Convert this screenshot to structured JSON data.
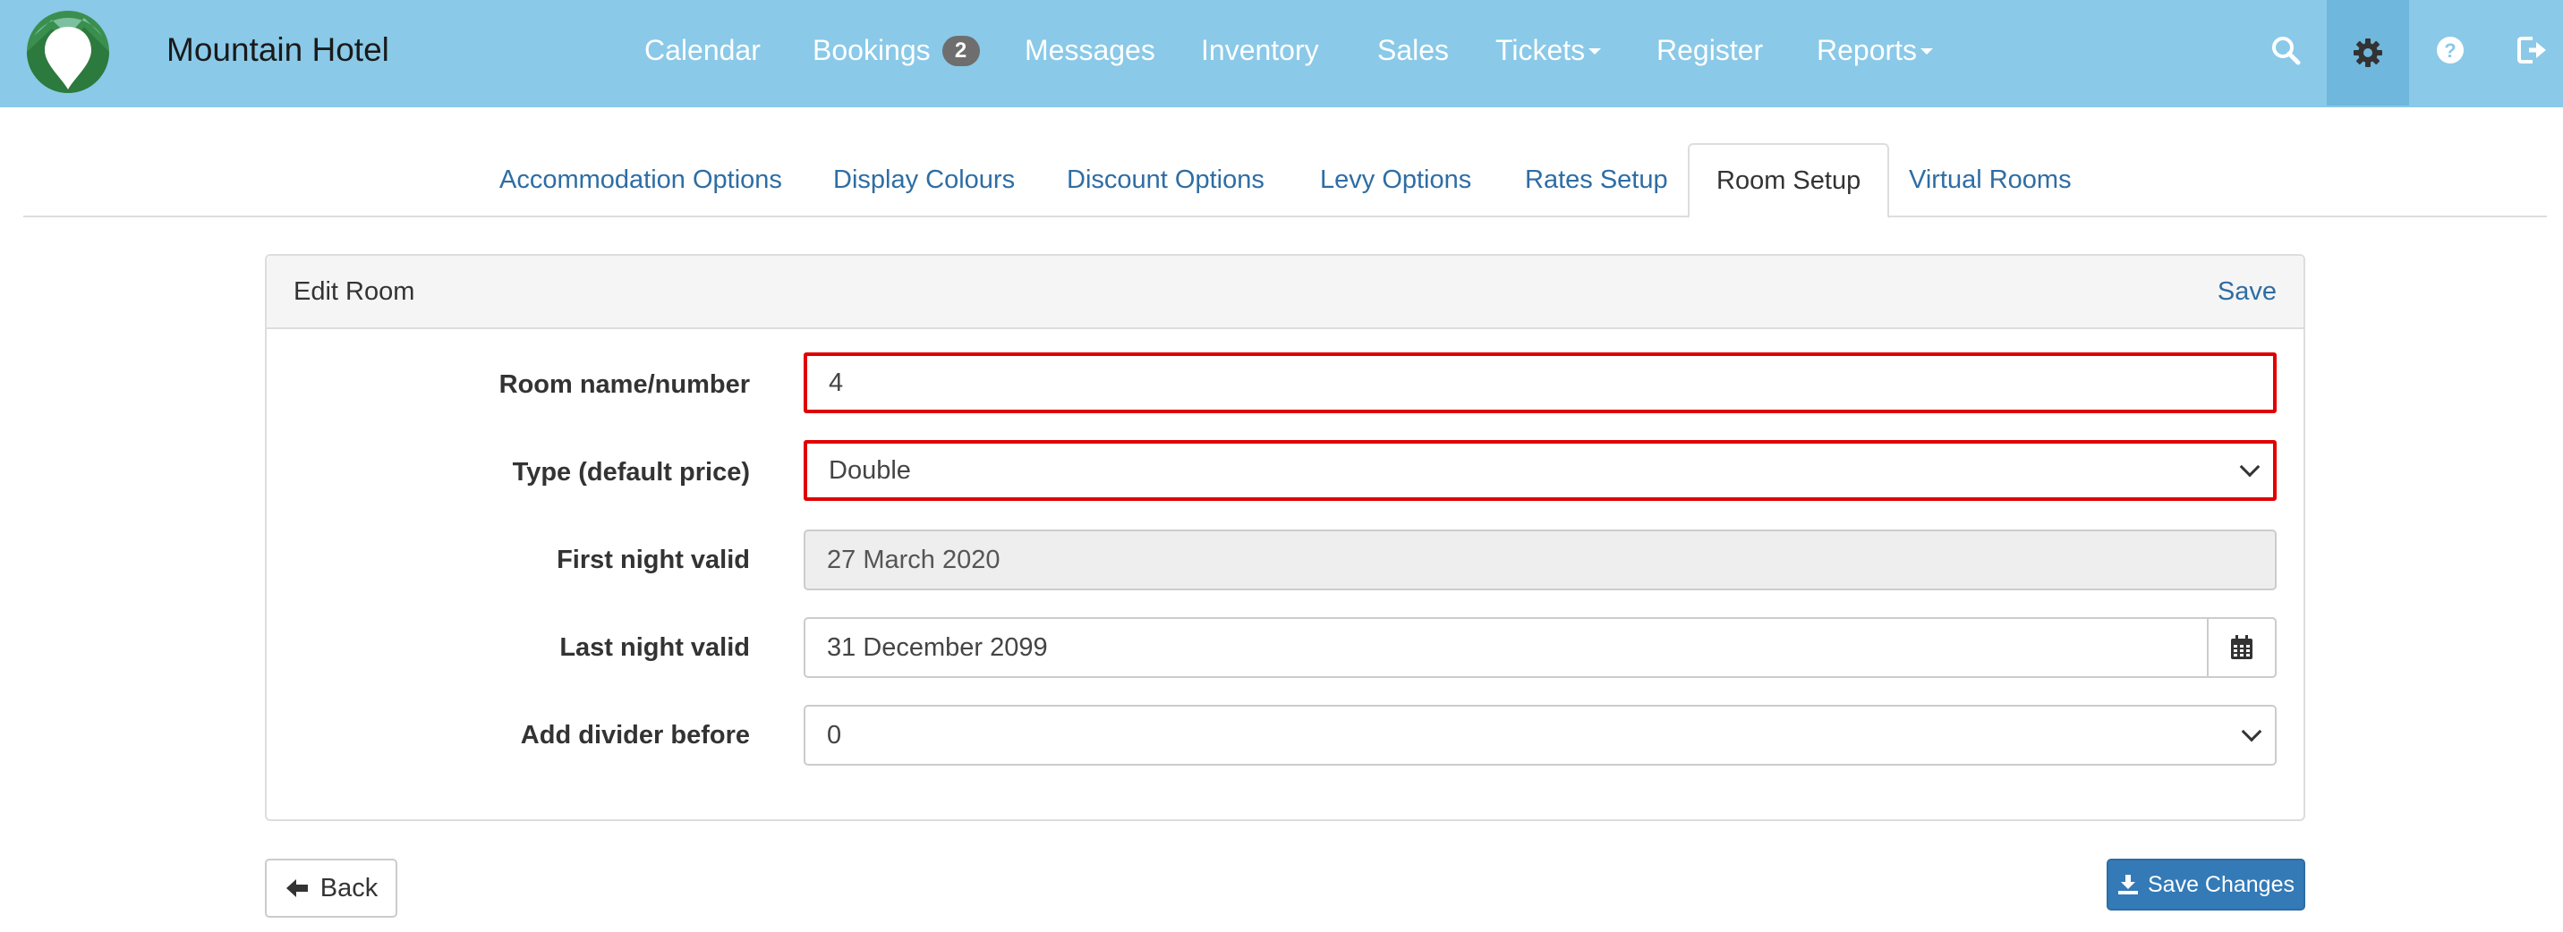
{
  "colors": {
    "navbar_bg": "#8ac9e8",
    "link": "#2e6da4",
    "primary_button": "#337ab7",
    "highlight_border": "#e00000"
  },
  "navbar": {
    "brand": "Mountain Hotel",
    "logo_icon": "mountain-pin-logo",
    "items": [
      {
        "label": "Calendar"
      },
      {
        "label": "Bookings",
        "badge": "2"
      },
      {
        "label": "Messages"
      },
      {
        "label": "Inventory"
      },
      {
        "label": "Sales"
      },
      {
        "label": "Tickets",
        "dropdown": true
      },
      {
        "label": "Register"
      },
      {
        "label": "Reports",
        "dropdown": true
      }
    ],
    "icons": [
      "search-icon",
      "gear-icon",
      "help-icon",
      "logout-icon"
    ],
    "active_icon": "gear-icon"
  },
  "tabs": [
    {
      "label": "Accommodation Options"
    },
    {
      "label": "Display Colours"
    },
    {
      "label": "Discount Options"
    },
    {
      "label": "Levy Options"
    },
    {
      "label": "Rates Setup"
    },
    {
      "label": "Room Setup",
      "active": true
    },
    {
      "label": "Virtual Rooms"
    }
  ],
  "panel": {
    "title": "Edit Room",
    "save_label": "Save",
    "fields": {
      "room_name": {
        "label": "Room name/number",
        "value": "4"
      },
      "type": {
        "label": "Type (default price)",
        "value": "Double"
      },
      "first_night": {
        "label": "First night valid",
        "value": "27 March 2020"
      },
      "last_night": {
        "label": "Last night valid",
        "value": "31 December 2099",
        "icon": "calendar-icon"
      },
      "divider": {
        "label": "Add divider before",
        "value": "0"
      }
    }
  },
  "buttons": {
    "back": {
      "label": "Back",
      "icon": "arrow-left-icon"
    },
    "save_changes": {
      "label": "Save Changes",
      "icon": "download-icon"
    }
  }
}
